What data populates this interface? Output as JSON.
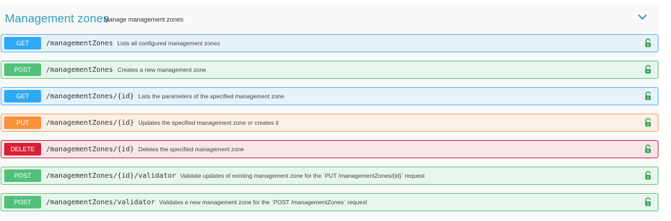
{
  "section": {
    "title": "Management zones",
    "description": "Manage management zones",
    "toggle_icon": "chevron-down-icon"
  },
  "operations": [
    {
      "method": "GET",
      "path": "/managementZones",
      "summary": "Lists all configured management zones",
      "lock_icon": "unlock-icon"
    },
    {
      "method": "POST",
      "path": "/managementZones",
      "summary": "Creates a new management zone",
      "lock_icon": "unlock-icon"
    },
    {
      "method": "GET",
      "path": "/managementZones/{id}",
      "summary": "Lists the parameters of the specified management zone",
      "lock_icon": "unlock-icon"
    },
    {
      "method": "PUT",
      "path": "/managementZones/{id}",
      "summary": "Updates the specified management zone or creates it",
      "lock_icon": "unlock-icon"
    },
    {
      "method": "DELETE",
      "path": "/managementZones/{id}",
      "summary": "Deletes the specified management zone",
      "lock_icon": "unlock-icon"
    },
    {
      "method": "POST",
      "path": "/managementZones/{id}/validator",
      "summary": "Validate updates of existing management zone for the `PUT /managementZones/{id}` request",
      "lock_icon": "unlock-icon"
    },
    {
      "method": "POST",
      "path": "/managementZones/validator",
      "summary": "Validates a new management zone for the `POST /managementZones` request",
      "lock_icon": "unlock-icon"
    }
  ],
  "colors": {
    "title": "#2f9fb8",
    "get": "#2fa9f4",
    "post": "#52c07a",
    "put": "#f99139",
    "delete": "#d71f35",
    "lock": "#3aa35e"
  }
}
